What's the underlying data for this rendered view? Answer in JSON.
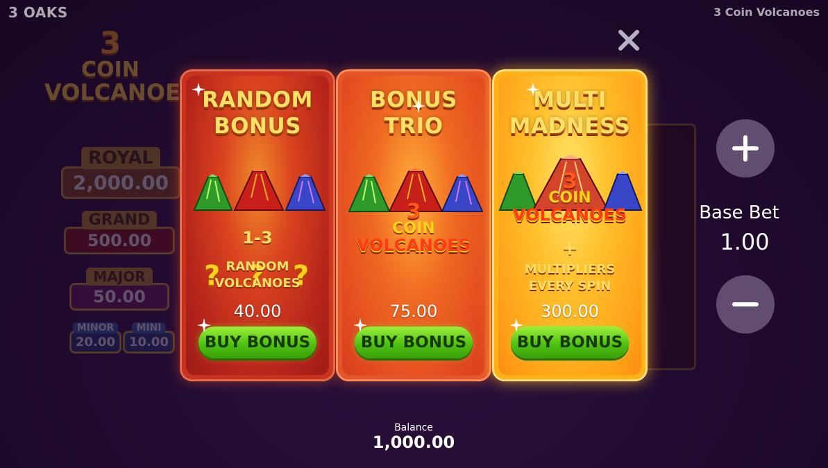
{
  "header": {
    "brand": "3 OAKS",
    "game_title": "3 Coin Volcanoes"
  },
  "background": {
    "logo": {
      "number": "3",
      "line1": "COIN",
      "line2": "VOLCANOES"
    },
    "jackpots": {
      "royal": {
        "label": "ROYAL",
        "value": "2,000.00"
      },
      "grand": {
        "label": "GRAND",
        "value": "500.00"
      },
      "major": {
        "label": "MAJOR",
        "value": "50.00"
      },
      "minor": {
        "label": "MINOR",
        "value": "20.00"
      },
      "mini": {
        "label": "MINI",
        "value": "10.00"
      }
    }
  },
  "cards": [
    {
      "title_line1": "RANDOM",
      "title_line2": "BONUS",
      "range": "1-3",
      "desc_line1": "RANDOM",
      "desc_line2": "VOLCANOES",
      "price": "40.00",
      "button": "BUY BONUS"
    },
    {
      "title_line1": "BONUS",
      "title_line2": "TRIO",
      "logo_number": "3",
      "logo_line1": "COIN",
      "logo_line2": "VOLCANOES",
      "price": "75.00",
      "button": "BUY BONUS"
    },
    {
      "title_line1": "MULTI",
      "title_line2": "MADNESS",
      "logo_number": "3",
      "logo_line1": "COIN",
      "logo_line2": "VOLCANOES",
      "plus": "+",
      "desc_line1": "MULTIPLIERS",
      "desc_line2": "EVERY SPIN",
      "price": "300.00",
      "button": "BUY BONUS"
    }
  ],
  "question_mark": "?",
  "bet": {
    "label": "Base Bet",
    "value": "1.00"
  },
  "balance": {
    "label": "Balance",
    "value": "1,000.00"
  },
  "icons": [
    "close-icon",
    "plus-icon",
    "minus-icon",
    "sparkle-icon",
    "volcano-icon"
  ],
  "colors": {
    "buy_button": "#4fc211",
    "title_gold": "#ffe066",
    "card1": "#c8331f",
    "card2": "#e5552a",
    "card3": "#ffb11c"
  }
}
